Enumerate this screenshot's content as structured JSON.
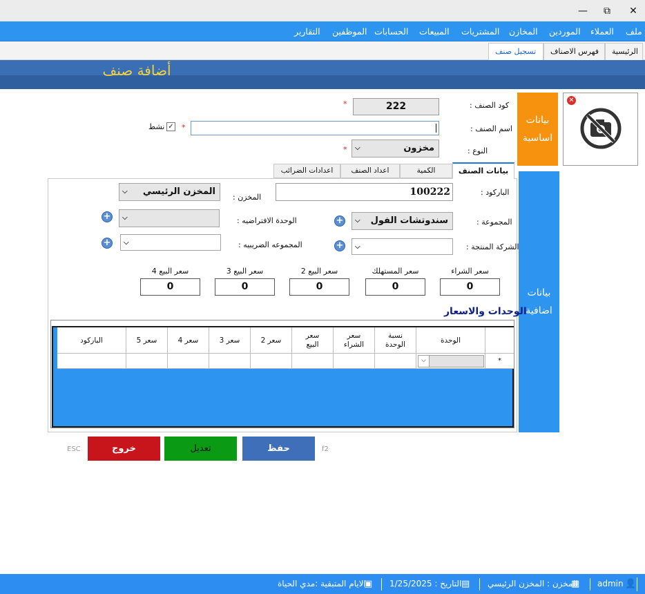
{
  "window": {
    "controls": {
      "close": "✕",
      "restore": "⧉",
      "minimize": "—"
    }
  },
  "menu": [
    "ملف",
    "العملاء",
    "الموردين",
    "المخازن",
    "المشتريات",
    "المبيعات",
    "الحسابات",
    "الموظفين",
    "التقارير"
  ],
  "tabs": [
    "الرئيسية",
    "فهرس الاصناف",
    "تسجيل صنف"
  ],
  "header": {
    "title": "أضافة صنف"
  },
  "basic": {
    "code_label": "كود الصنف :",
    "code_value": "222",
    "name_label": "اسم الصنف :",
    "name_value": "",
    "active_label": "نشط",
    "type_label": "النوع :",
    "type_value": "مخزون",
    "required_mark": "*"
  },
  "side": {
    "basic_btn": "بيانات\nاساسية",
    "extra_btn": "بيانات\nاضافية"
  },
  "inner_tabs": [
    "بيانات الصنف",
    "الكمية",
    "اعداد الصنف",
    "اعدادات الضرائب"
  ],
  "item": {
    "barcode_label": "الباركود :",
    "barcode_value": "100222",
    "store_label": "المخزن :",
    "store_value": "المخزن الرئيسي",
    "group_label": "المجموعة :",
    "group_value": "سندوتشات الفول",
    "default_unit_label": "الوحدة الافتراضيه :",
    "default_unit_value": "",
    "maker_label": "الشركة المنتجة :",
    "maker_value": "",
    "tax_group_label": "المجموعه الضريبيه :",
    "tax_group_value": ""
  },
  "prices": [
    {
      "label": "سعر الشراء",
      "value": "0"
    },
    {
      "label": "سعر المستهلك",
      "value": "0"
    },
    {
      "label": "سعر البيع 2",
      "value": "0"
    },
    {
      "label": "سعر البيع 3",
      "value": "0"
    },
    {
      "label": "سعر البيع 4",
      "value": "0"
    }
  ],
  "units": {
    "title": "الوحدات والاسعار",
    "columns": [
      "الوحدة",
      "نسبة\nالوحدة",
      "سعر\nالشراء",
      "سعر\nالبيع",
      "سعر 2",
      "سعر 3",
      "سعر 4",
      "سعر 5",
      "الباركود"
    ],
    "new_row_marker": "*"
  },
  "actions": {
    "save": "حفظ",
    "edit": "تعديل",
    "exit": "خروج",
    "save_hint": "f2",
    "exit_hint": "ESC"
  },
  "status": {
    "user": "admin",
    "store": "المخزن : المخزن الرئيسي",
    "date": "التاريخ : 1/25/2025",
    "remaining": "الايام المتبقية :مدي الحياة"
  },
  "colors": {
    "menu": "#2d95f0",
    "banner": "#3a6fb5",
    "title": "#f6d33a",
    "basic_btn": "#f7920f",
    "extra_btn": "#2d95f0",
    "save": "#3f6fb8",
    "edit": "#0a9a14",
    "exit": "#c8141b",
    "grid_bg": "#2d95f0"
  }
}
